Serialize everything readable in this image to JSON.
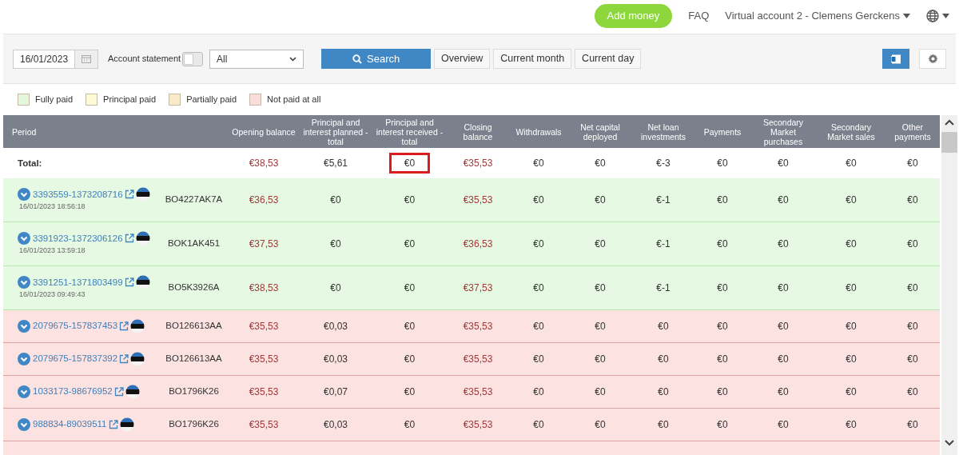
{
  "topbar": {
    "add_money": "Add money",
    "faq": "FAQ",
    "account": "Virtual account 2 - Clemens Gerckens"
  },
  "filters": {
    "date": "16/01/2023",
    "statement_label": "Account statement",
    "statement_on": false,
    "select_value": "All",
    "search": "Search",
    "buttons": [
      "Overview",
      "Current month",
      "Current day"
    ]
  },
  "legend": [
    {
      "label": "Fully paid",
      "color": "#e3f7dd"
    },
    {
      "label": "Principal paid",
      "color": "#fdfbd6"
    },
    {
      "label": "Partially paid",
      "color": "#fbeac8"
    },
    {
      "label": "Not paid at all",
      "color": "#fbdcdc"
    }
  ],
  "table": {
    "columns": [
      {
        "label": "Period"
      },
      {},
      {
        "label": "Opening balance",
        "accent": true
      },
      {
        "label": "Principal and interest planned - total",
        "accent": false
      },
      {
        "label": "Principal and interest received - total",
        "accent": false
      },
      {
        "label": "Closing balance",
        "accent": true
      },
      {
        "label": "Withdrawals",
        "accent": false
      },
      {
        "label": "Net capital deployed",
        "accent": false
      },
      {
        "label": "Net loan investments",
        "accent": false
      },
      {
        "label": "Payments",
        "accent": false
      },
      {
        "label": "Secondary Market purchases",
        "accent": false
      },
      {
        "label": "Secondary Market sales",
        "accent": false
      },
      {
        "label": "Other payments",
        "accent": false
      }
    ],
    "total": {
      "label": "Total:",
      "cells": [
        {
          "text": "€38,53",
          "highlighted": false
        },
        {
          "text": "€5,61",
          "highlighted": false
        },
        {
          "text": "€0",
          "highlighted": true
        },
        {
          "text": "€35,53",
          "highlighted": false
        },
        {
          "text": "€0",
          "highlighted": false
        },
        {
          "text": "€0",
          "highlighted": false
        },
        {
          "text": "€-3",
          "highlighted": false
        },
        {
          "text": "€0",
          "highlighted": false
        },
        {
          "text": "€0",
          "highlighted": false
        },
        {
          "text": "€0",
          "highlighted": false
        },
        {
          "text": "€0",
          "highlighted": false
        }
      ]
    },
    "rows": [
      {
        "color": "#e6f9e3",
        "id": "3393559-1373208716",
        "time": "16/01/2023 18:56:18",
        "code": "BO4227AK7A",
        "values": [
          "€36,53",
          "€0",
          "€0",
          "€35,53",
          "€0",
          "€0",
          "€-1",
          "€0",
          "€0",
          "€0",
          "€0"
        ]
      },
      {
        "color": "#e6f9e3",
        "id": "3391923-1372306126",
        "time": "16/01/2023 13:59:18",
        "code": "BOK1AK451",
        "values": [
          "€37,53",
          "€0",
          "€0",
          "€36,53",
          "€0",
          "€0",
          "€-1",
          "€0",
          "€0",
          "€0",
          "€0"
        ]
      },
      {
        "color": "#e6f9e3",
        "id": "3391251-1371803499",
        "time": "16/01/2023 09:49:43",
        "code": "BO5K3926A",
        "values": [
          "€38,53",
          "€0",
          "€0",
          "€37,53",
          "€0",
          "€0",
          "€-1",
          "€0",
          "€0",
          "€0",
          "€0"
        ]
      },
      {
        "color": "#fde2e2",
        "id": "2079675-157837453",
        "code": "BO126613AA",
        "values": [
          "€35,53",
          "€0,03",
          "€0",
          "€35,53",
          "€0",
          "€0",
          "€0",
          "€0",
          "€0",
          "€0",
          "€0"
        ]
      },
      {
        "color": "#fde2e2",
        "id": "2079675-157837392",
        "code": "BO126613AA",
        "values": [
          "€35,53",
          "€0,03",
          "€0",
          "€35,53",
          "€0",
          "€0",
          "€0",
          "€0",
          "€0",
          "€0",
          "€0"
        ]
      },
      {
        "color": "#fde2e2",
        "id": "1033173-98676952",
        "code": "BO1796K26",
        "values": [
          "€35,53",
          "€0,07",
          "€0",
          "€35,53",
          "€0",
          "€0",
          "€0",
          "€0",
          "€0",
          "€0",
          "€0"
        ]
      },
      {
        "color": "#fde2e2",
        "id": "988834-89039511",
        "code": "BO1796K26",
        "values": [
          "€35,53",
          "€0,03",
          "€0",
          "€35,53",
          "€0",
          "€0",
          "€0",
          "€0",
          "€0",
          "€0",
          "€0"
        ]
      }
    ]
  }
}
